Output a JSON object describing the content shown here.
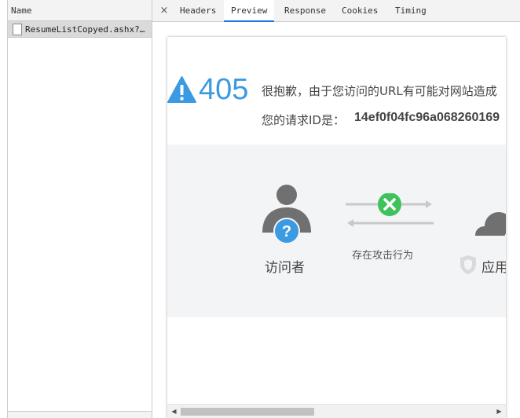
{
  "requests": {
    "header": "Name",
    "items": [
      {
        "name": "ResumeListCopyed.ashx?…"
      }
    ]
  },
  "tabs": [
    {
      "label": "Headers",
      "active": false
    },
    {
      "label": "Preview",
      "active": true
    },
    {
      "label": "Response",
      "active": false
    },
    {
      "label": "Cookies",
      "active": false
    },
    {
      "label": "Timing",
      "active": false
    }
  ],
  "close_tab_symbol": "×",
  "preview": {
    "error_code": "405",
    "message": "很抱歉，由于您访问的URL有可能对网站造成",
    "request_id_label": "您的请求ID是：",
    "request_id_value": "14ef0f04fc96a068260169",
    "visitor_label": "访问者",
    "attack_label": "存在攻击行为",
    "app_label": "应用"
  },
  "scrollbar": {
    "left_arrow": "◀",
    "right_arrow": "▶"
  },
  "colors": {
    "accent_blue": "#3b9ae1",
    "tab_underline": "#1a73e8",
    "success_green": "#3ec35b",
    "avatar_gray": "#707070"
  }
}
